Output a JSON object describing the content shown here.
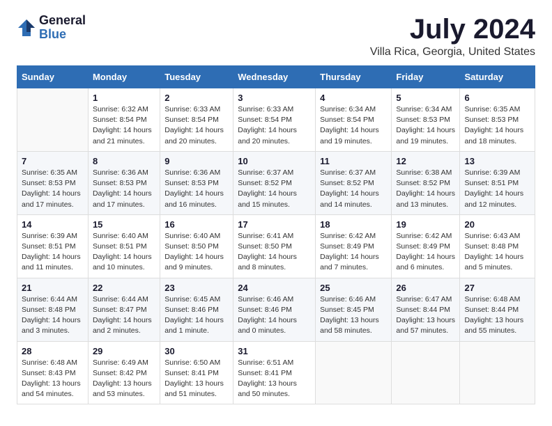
{
  "logo": {
    "general": "General",
    "blue": "Blue"
  },
  "header": {
    "title": "July 2024",
    "subtitle": "Villa Rica, Georgia, United States"
  },
  "calendar": {
    "columns": [
      "Sunday",
      "Monday",
      "Tuesday",
      "Wednesday",
      "Thursday",
      "Friday",
      "Saturday"
    ],
    "rows": [
      [
        {
          "day": "",
          "info": ""
        },
        {
          "day": "1",
          "info": "Sunrise: 6:32 AM\nSunset: 8:54 PM\nDaylight: 14 hours and 21 minutes."
        },
        {
          "day": "2",
          "info": "Sunrise: 6:33 AM\nSunset: 8:54 PM\nDaylight: 14 hours and 20 minutes."
        },
        {
          "day": "3",
          "info": "Sunrise: 6:33 AM\nSunset: 8:54 PM\nDaylight: 14 hours and 20 minutes."
        },
        {
          "day": "4",
          "info": "Sunrise: 6:34 AM\nSunset: 8:54 PM\nDaylight: 14 hours and 19 minutes."
        },
        {
          "day": "5",
          "info": "Sunrise: 6:34 AM\nSunset: 8:53 PM\nDaylight: 14 hours and 19 minutes."
        },
        {
          "day": "6",
          "info": "Sunrise: 6:35 AM\nSunset: 8:53 PM\nDaylight: 14 hours and 18 minutes."
        }
      ],
      [
        {
          "day": "7",
          "info": "Sunrise: 6:35 AM\nSunset: 8:53 PM\nDaylight: 14 hours and 17 minutes."
        },
        {
          "day": "8",
          "info": "Sunrise: 6:36 AM\nSunset: 8:53 PM\nDaylight: 14 hours and 17 minutes."
        },
        {
          "day": "9",
          "info": "Sunrise: 6:36 AM\nSunset: 8:53 PM\nDaylight: 14 hours and 16 minutes."
        },
        {
          "day": "10",
          "info": "Sunrise: 6:37 AM\nSunset: 8:52 PM\nDaylight: 14 hours and 15 minutes."
        },
        {
          "day": "11",
          "info": "Sunrise: 6:37 AM\nSunset: 8:52 PM\nDaylight: 14 hours and 14 minutes."
        },
        {
          "day": "12",
          "info": "Sunrise: 6:38 AM\nSunset: 8:52 PM\nDaylight: 14 hours and 13 minutes."
        },
        {
          "day": "13",
          "info": "Sunrise: 6:39 AM\nSunset: 8:51 PM\nDaylight: 14 hours and 12 minutes."
        }
      ],
      [
        {
          "day": "14",
          "info": "Sunrise: 6:39 AM\nSunset: 8:51 PM\nDaylight: 14 hours and 11 minutes."
        },
        {
          "day": "15",
          "info": "Sunrise: 6:40 AM\nSunset: 8:51 PM\nDaylight: 14 hours and 10 minutes."
        },
        {
          "day": "16",
          "info": "Sunrise: 6:40 AM\nSunset: 8:50 PM\nDaylight: 14 hours and 9 minutes."
        },
        {
          "day": "17",
          "info": "Sunrise: 6:41 AM\nSunset: 8:50 PM\nDaylight: 14 hours and 8 minutes."
        },
        {
          "day": "18",
          "info": "Sunrise: 6:42 AM\nSunset: 8:49 PM\nDaylight: 14 hours and 7 minutes."
        },
        {
          "day": "19",
          "info": "Sunrise: 6:42 AM\nSunset: 8:49 PM\nDaylight: 14 hours and 6 minutes."
        },
        {
          "day": "20",
          "info": "Sunrise: 6:43 AM\nSunset: 8:48 PM\nDaylight: 14 hours and 5 minutes."
        }
      ],
      [
        {
          "day": "21",
          "info": "Sunrise: 6:44 AM\nSunset: 8:48 PM\nDaylight: 14 hours and 3 minutes."
        },
        {
          "day": "22",
          "info": "Sunrise: 6:44 AM\nSunset: 8:47 PM\nDaylight: 14 hours and 2 minutes."
        },
        {
          "day": "23",
          "info": "Sunrise: 6:45 AM\nSunset: 8:46 PM\nDaylight: 14 hours and 1 minute."
        },
        {
          "day": "24",
          "info": "Sunrise: 6:46 AM\nSunset: 8:46 PM\nDaylight: 14 hours and 0 minutes."
        },
        {
          "day": "25",
          "info": "Sunrise: 6:46 AM\nSunset: 8:45 PM\nDaylight: 13 hours and 58 minutes."
        },
        {
          "day": "26",
          "info": "Sunrise: 6:47 AM\nSunset: 8:44 PM\nDaylight: 13 hours and 57 minutes."
        },
        {
          "day": "27",
          "info": "Sunrise: 6:48 AM\nSunset: 8:44 PM\nDaylight: 13 hours and 55 minutes."
        }
      ],
      [
        {
          "day": "28",
          "info": "Sunrise: 6:48 AM\nSunset: 8:43 PM\nDaylight: 13 hours and 54 minutes."
        },
        {
          "day": "29",
          "info": "Sunrise: 6:49 AM\nSunset: 8:42 PM\nDaylight: 13 hours and 53 minutes."
        },
        {
          "day": "30",
          "info": "Sunrise: 6:50 AM\nSunset: 8:41 PM\nDaylight: 13 hours and 51 minutes."
        },
        {
          "day": "31",
          "info": "Sunrise: 6:51 AM\nSunset: 8:41 PM\nDaylight: 13 hours and 50 minutes."
        },
        {
          "day": "",
          "info": ""
        },
        {
          "day": "",
          "info": ""
        },
        {
          "day": "",
          "info": ""
        }
      ]
    ]
  }
}
